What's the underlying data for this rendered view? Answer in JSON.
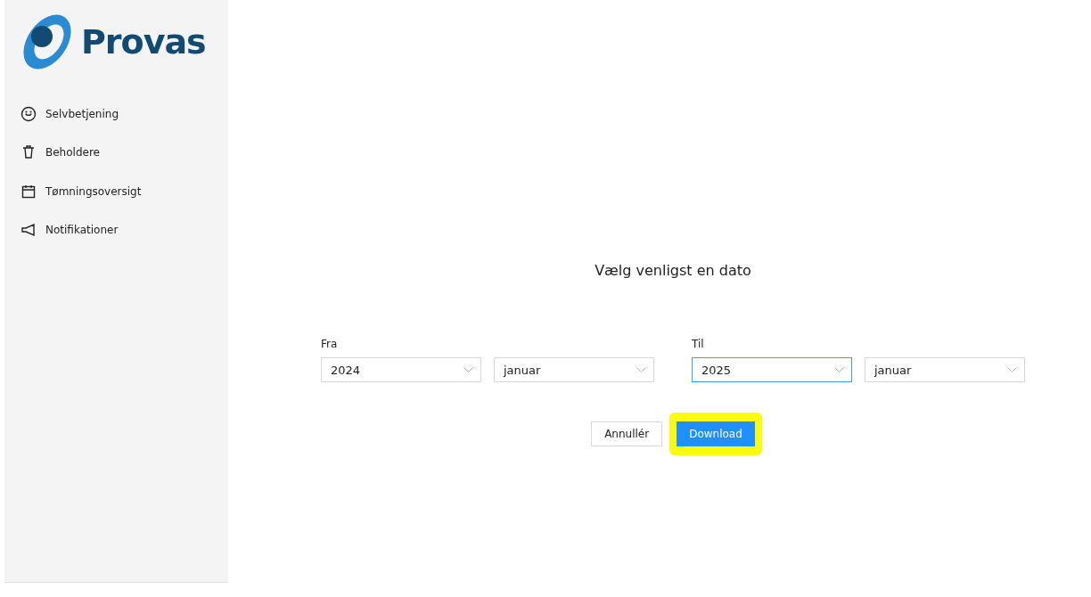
{
  "logo": {
    "text": "Provas"
  },
  "sidebar": {
    "items": [
      {
        "kind": "smile",
        "label": "Selvbetjening"
      },
      {
        "kind": "bin",
        "label": "Beholdere"
      },
      {
        "kind": "calendar",
        "label": "Tømningsoversigt"
      },
      {
        "kind": "megaphone",
        "label": "Notifikationer"
      }
    ]
  },
  "dialog": {
    "title": "Vælg venligst en dato",
    "groups": [
      {
        "label": "Fra",
        "selects": [
          {
            "value": "2024",
            "focused": false
          },
          {
            "value": "januar",
            "focused": false
          }
        ]
      },
      {
        "label": "Til",
        "selects": [
          {
            "value": "2025",
            "focused": true
          },
          {
            "value": "januar",
            "focused": false
          }
        ]
      }
    ],
    "buttons": [
      {
        "kind": "secondary",
        "label": "Annullér",
        "highlighted": false
      },
      {
        "kind": "primary",
        "label": "Download",
        "highlighted": true
      }
    ]
  }
}
